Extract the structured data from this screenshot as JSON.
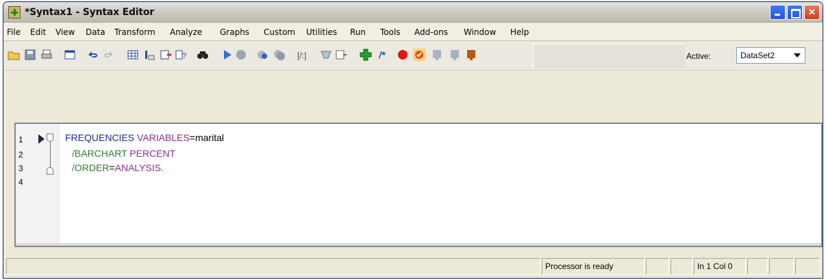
{
  "window": {
    "title": "*Syntax1 - Syntax Editor"
  },
  "menu": [
    {
      "label": "File"
    },
    {
      "label": "Edit"
    },
    {
      "label": "View"
    },
    {
      "label": "Data"
    },
    {
      "label": "Transform"
    },
    {
      "label": "Analyze"
    },
    {
      "label": "Graphs"
    },
    {
      "label": "Custom"
    },
    {
      "label": "Utilities"
    },
    {
      "label": "Run"
    },
    {
      "label": "Tools"
    },
    {
      "label": "Add-ons"
    },
    {
      "label": "Window"
    },
    {
      "label": "Help"
    }
  ],
  "toolbar": {
    "active_label": "Active:",
    "active_dataset": "DataSet2",
    "icons": [
      "open-folder",
      "save",
      "print",
      "dialog-recall",
      "undo",
      "redo",
      "goto-data",
      "goto-variable",
      "insert-cases",
      "variables",
      "find",
      "run-selection",
      "stop",
      "show-errors",
      "run-all",
      "wrap",
      "comment",
      "uncomment",
      "run-block",
      "add-green",
      "comment-toggle",
      "breakpoint",
      "bookmark",
      "step",
      "stop-debug",
      "step-over"
    ],
    "colors": {
      "title_gradient_top": "#e4e3df",
      "close_button": "#c9401f",
      "accent_blue": "#2456d4"
    }
  },
  "editor": {
    "line_numbers": [
      "1",
      "2",
      "3",
      "4"
    ],
    "lines": [
      {
        "tokens": [
          {
            "text": "FREQUENCIES ",
            "style": "blue"
          },
          {
            "text": "VARIABLES",
            "style": "purple"
          },
          {
            "text": "=marital",
            "style": "plain"
          }
        ]
      },
      {
        "tokens": [
          {
            "text": "/BARCHART ",
            "style": "green"
          },
          {
            "text": "PERCENT",
            "style": "purple"
          }
        ]
      },
      {
        "tokens": [
          {
            "text": "/ORDER",
            "style": "green"
          },
          {
            "text": "=",
            "style": "plain"
          },
          {
            "text": "ANALYSIS.",
            "style": "purple"
          }
        ]
      }
    ]
  },
  "status": {
    "processor": "Processor is ready",
    "position": "In 1 Col 0"
  }
}
